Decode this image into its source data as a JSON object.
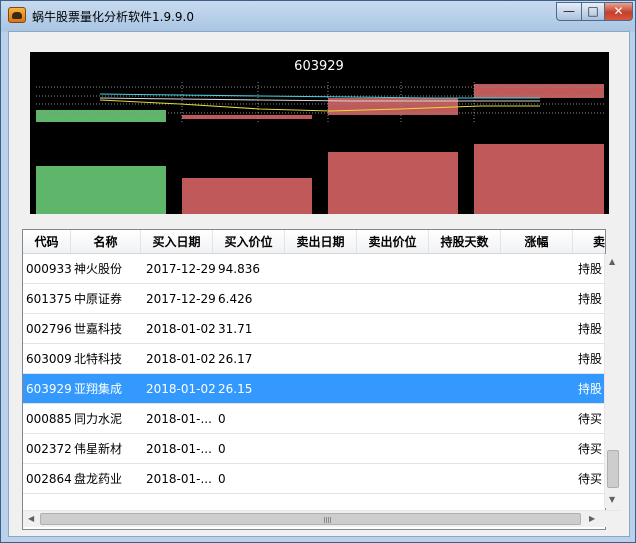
{
  "window": {
    "title": "蜗牛股票量化分析软件1.9.9.0",
    "minimize_glyph": "—",
    "maximize_glyph": "□",
    "close_glyph": "✕"
  },
  "chart": {
    "title": "603929"
  },
  "table": {
    "columns": [
      "代码",
      "名称",
      "买入日期",
      "买入价位",
      "卖出日期",
      "卖出价位",
      "持股天数",
      "涨幅",
      "卖"
    ],
    "rows": [
      [
        "000933",
        "神火股份",
        "2017-12-29",
        "94.836",
        "",
        "",
        "",
        "",
        "持股"
      ],
      [
        "601375",
        "中原证券",
        "2017-12-29",
        "6.426",
        "",
        "",
        "",
        "",
        "持股"
      ],
      [
        "002796",
        "世嘉科技",
        "2018-01-02",
        "31.71",
        "",
        "",
        "",
        "",
        "持股"
      ],
      [
        "603009",
        "北特科技",
        "2018-01-02",
        "26.17",
        "",
        "",
        "",
        "",
        "持股"
      ],
      [
        "603929",
        "亚翔集成",
        "2018-01-02",
        "26.15",
        "",
        "",
        "",
        "",
        "持股"
      ],
      [
        "000885",
        "同力水泥",
        "2018-01-...",
        "0",
        "",
        "",
        "",
        "",
        "待买"
      ],
      [
        "002372",
        "伟星新材",
        "2018-01-...",
        "0",
        "",
        "",
        "",
        "",
        "待买"
      ],
      [
        "002864",
        "盘龙药业",
        "2018-01-...",
        "0",
        "",
        "",
        "",
        "",
        "待买"
      ]
    ],
    "selected_row": 4
  },
  "colors": {
    "up_bar": "#c05a5a",
    "down_bar": "#5fb56a",
    "line_cyan": "#4fd0e0",
    "line_yellow": "#e6dc3c",
    "selection": "#3399ff"
  }
}
